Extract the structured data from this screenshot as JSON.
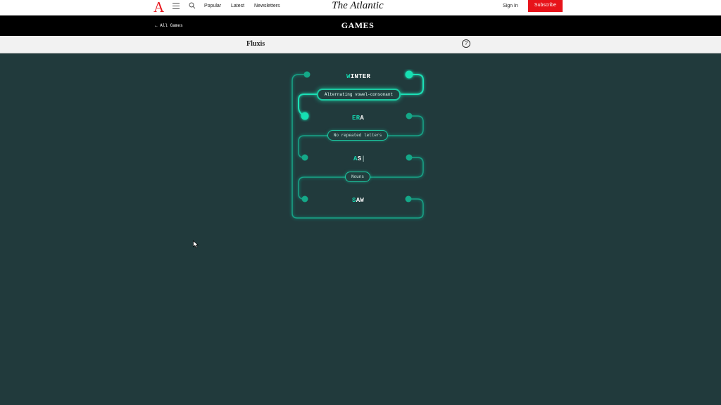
{
  "nav": {
    "logo": "A",
    "links": [
      "Popular",
      "Latest",
      "Newsletters"
    ],
    "brand": "The Atlantic",
    "sign_in": "Sign In",
    "subscribe": "Subscribe"
  },
  "games_bar": {
    "back_link": "← All Games",
    "title": "GAMES"
  },
  "game": {
    "name": "Fluxis",
    "help_icon": "?"
  },
  "puzzle": {
    "words": [
      {
        "highlight": "W",
        "rest": "INTER"
      },
      {
        "highlight": "ER",
        "rest": "A"
      },
      {
        "highlight": "A",
        "rest": "S",
        "cursor": "|"
      },
      {
        "highlight": "S",
        "rest": "AW"
      }
    ],
    "rules": [
      "Alternating vowel-consonant",
      "No repeated letters",
      "Nouns"
    ],
    "accent_color": "#16d7b0",
    "background_color": "#213a3c"
  }
}
